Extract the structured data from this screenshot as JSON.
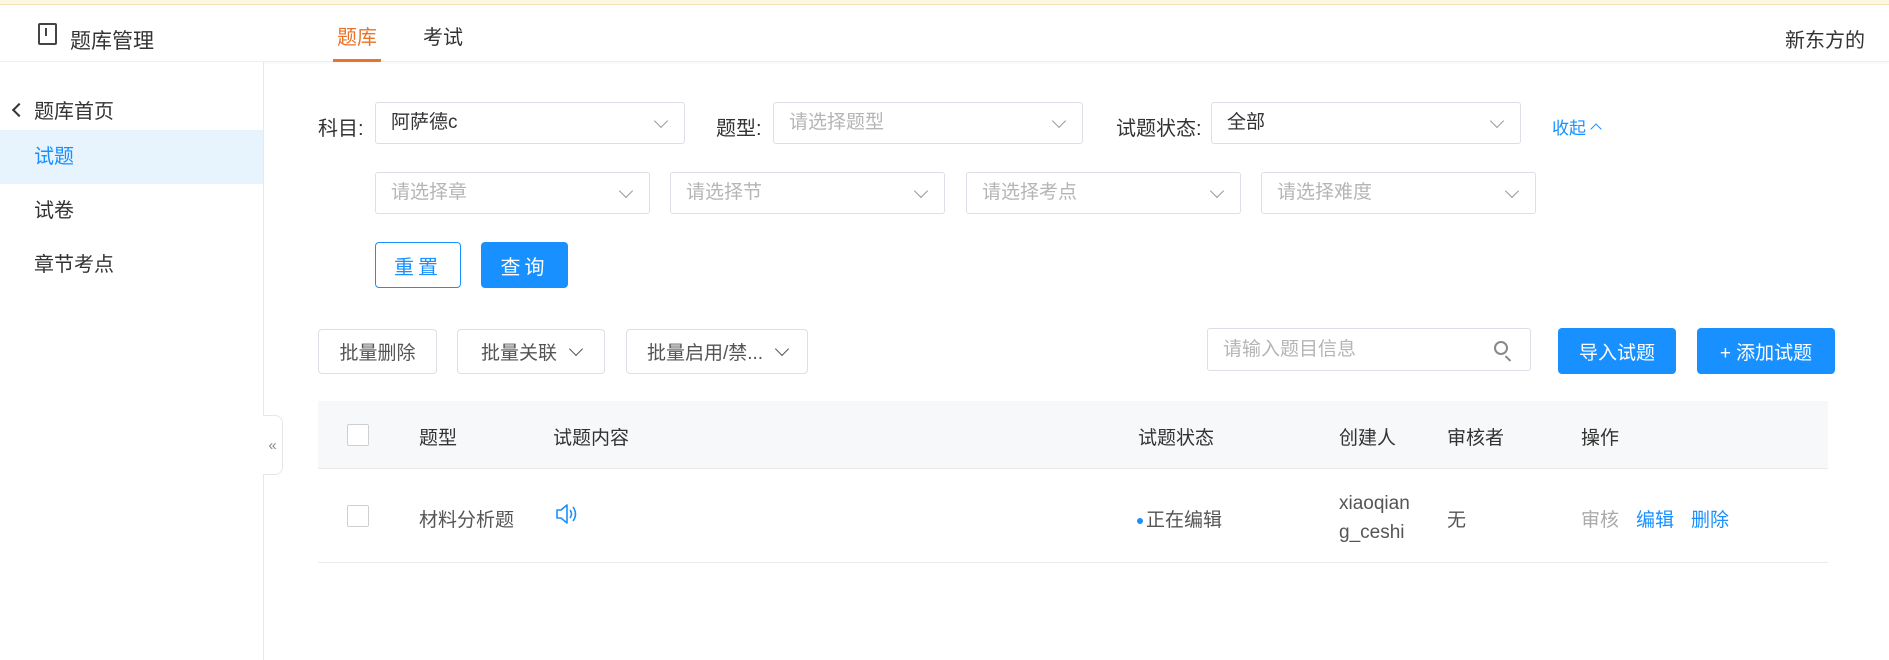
{
  "header": {
    "app_title": "题库管理",
    "tabs": [
      {
        "label": "题库"
      },
      {
        "label": "考试"
      }
    ],
    "user_name": "新东方的"
  },
  "sidebar": {
    "back_label": "题库首页",
    "items": [
      {
        "label": "试题"
      },
      {
        "label": "试卷"
      },
      {
        "label": "章节考点"
      }
    ],
    "collapse_glyph": "«"
  },
  "filters": {
    "subject_label": "科目:",
    "subject_value": "阿萨德c",
    "type_label": "题型:",
    "type_placeholder": "请选择题型",
    "status_label": "试题状态:",
    "status_value": "全部",
    "collapse_label": "收起",
    "chapter_placeholder": "请选择章",
    "section_placeholder": "请选择节",
    "point_placeholder": "请选择考点",
    "difficulty_placeholder": "请选择难度",
    "reset_label": "重置",
    "query_label": "查询"
  },
  "toolbar": {
    "batch_delete": "批量删除",
    "batch_link": "批量关联",
    "batch_toggle": "批量启用/禁...",
    "search_placeholder": "请输入题目信息",
    "import_label": "导入试题",
    "add_label": "+ 添加试题"
  },
  "table": {
    "columns": [
      "题型",
      "试题内容",
      "试题状态",
      "创建人",
      "审核者",
      "操作"
    ],
    "rows": [
      {
        "type": "材料分析题",
        "status": "正在编辑",
        "creator_line1": "xiaoqian",
        "creator_line2": "g_ceshi",
        "reviewer": "无",
        "actions": {
          "review": "审核",
          "edit": "编辑",
          "delete": "删除"
        }
      }
    ]
  },
  "colors": {
    "accent": "#1890ff",
    "tab_active": "#e8742a",
    "sidebar_active_bg": "#e8f4fd"
  }
}
